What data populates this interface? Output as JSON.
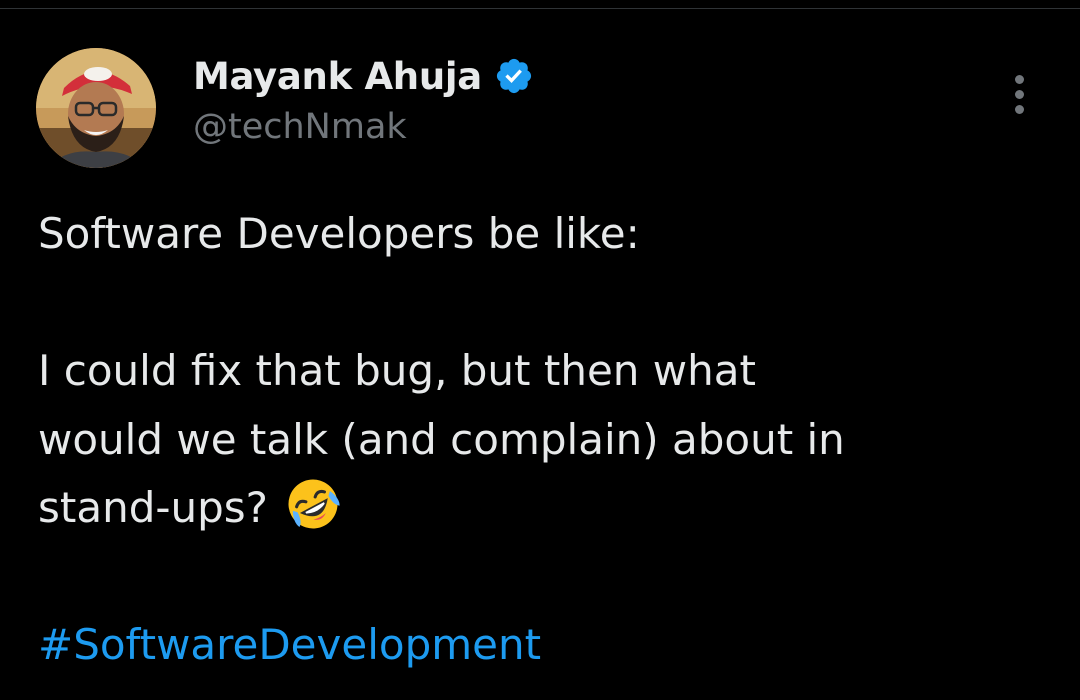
{
  "author": {
    "display_name": "Mayank Ahuja",
    "handle": "@techNmak",
    "avatar_icon": "profile-photo",
    "verified_icon": "verified-badge-icon",
    "verified_color": "#1d9bf0"
  },
  "menu": {
    "icon": "more-vertical-icon"
  },
  "tweet": {
    "line_1": "Software Developers be like:",
    "line_2": "I could fix that bug, but then what",
    "line_3": "would we talk (and complain) about in",
    "line_4": "stand-ups?",
    "emoji": "rolling-on-floor-laughing-emoji",
    "hashtag": "#SoftwareDevelopment"
  },
  "colors": {
    "background": "#000000",
    "text": "#e7e9ea",
    "secondary_text": "#71767b",
    "link": "#1d9bf0"
  }
}
